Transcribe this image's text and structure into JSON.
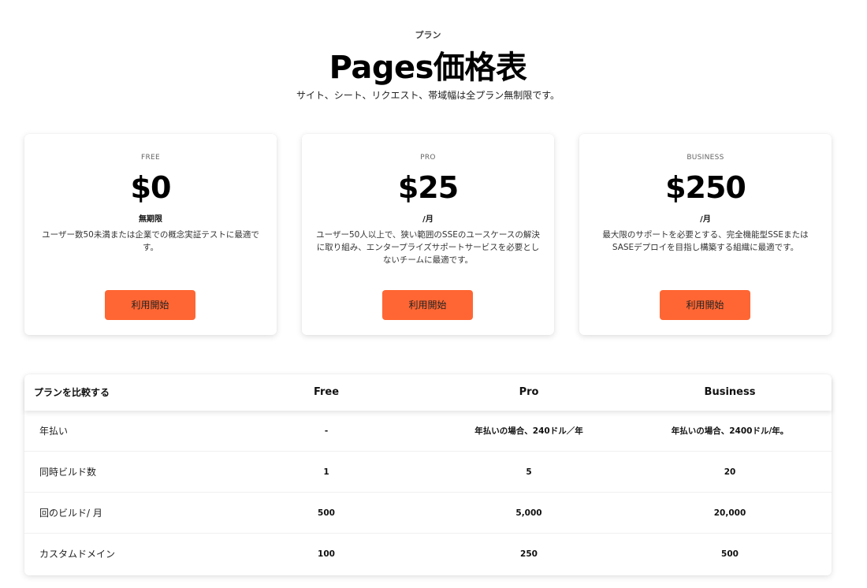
{
  "header": {
    "eyebrow": "プラン",
    "title": "Pages価格表",
    "subtitle": "サイト、シート、リクエスト、帯域幅は全プラン無制限です。"
  },
  "plans": [
    {
      "name": "FREE",
      "price": "$0",
      "period": "無期限",
      "description": "ユーザー数50未満または企業での概念実証テストに最適です。",
      "cta": "利用開始"
    },
    {
      "name": "PRO",
      "price": "$25",
      "period": "/月",
      "description": "ユーザー50人以上で、狭い範囲のSSEのユースケースの解決に取り組み、エンタープライズサポートサービスを必要としないチームに最適です。",
      "cta": "利用開始"
    },
    {
      "name": "BUSINESS",
      "price": "$250",
      "period": "/月",
      "description": "最大限のサポートを必要とする、完全機能型SSEまたはSASEデプロイを目指し構築する組織に最適です。",
      "cta": "利用開始"
    }
  ],
  "comparison": {
    "headers": [
      "プランを比較する",
      "Free",
      "Pro",
      "Business"
    ],
    "rows": [
      {
        "label": "年払い",
        "free": "-",
        "pro": "年払いの場合、240ドル／年",
        "business": "年払いの場合、2400ドル/年。"
      },
      {
        "label": "同時ビルド数",
        "free": "1",
        "pro": "5",
        "business": "20"
      },
      {
        "label": "回のビルド/ 月",
        "free": "500",
        "pro": "5,000",
        "business": "20,000"
      },
      {
        "label": "カスタムドメイン",
        "free": "100",
        "pro": "250",
        "business": "500"
      }
    ]
  },
  "colors": {
    "accent": "#ff6633",
    "background": "#ffffff",
    "text": "#111111"
  }
}
